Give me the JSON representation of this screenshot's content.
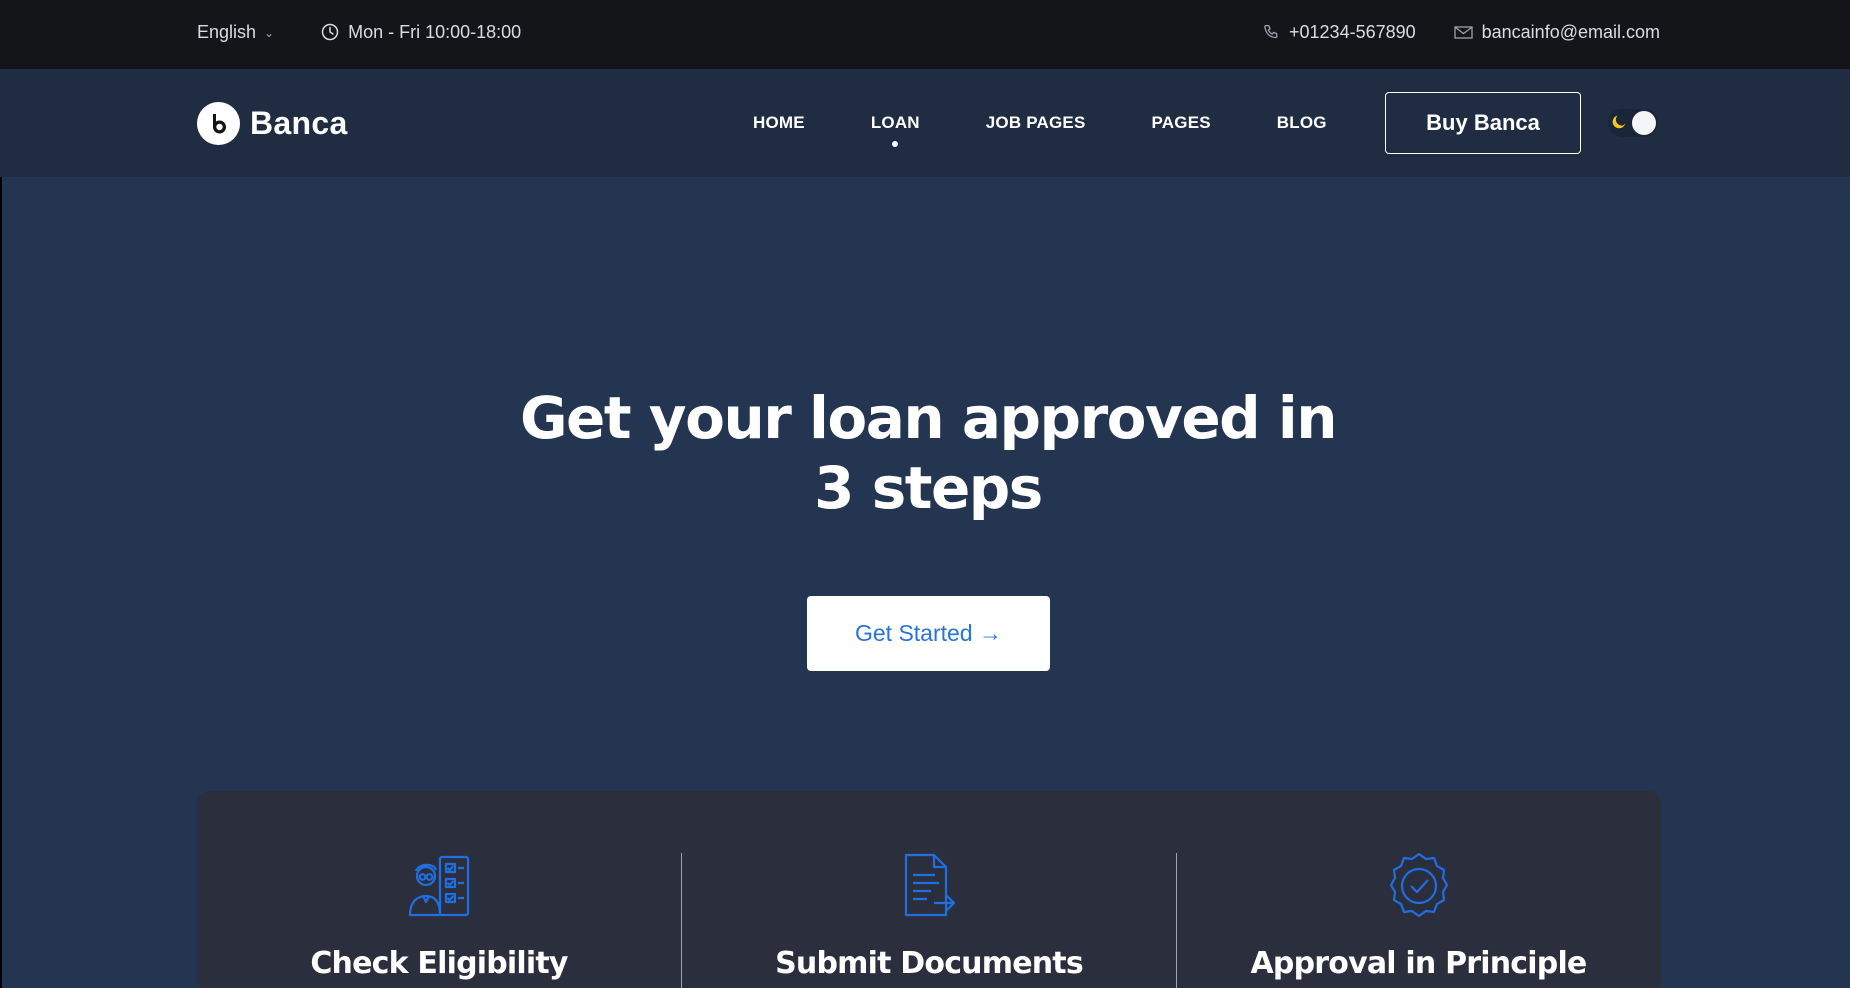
{
  "topbar": {
    "language": "English",
    "hours": "Mon - Fri 10:00-18:00",
    "phone": "+01234-567890",
    "email": "bancainfo@email.com"
  },
  "nav": {
    "logo_text": "Banca",
    "items": [
      {
        "label": "HOME",
        "active": false
      },
      {
        "label": "LOAN",
        "active": true
      },
      {
        "label": "JOB PAGES",
        "active": false
      },
      {
        "label": "PAGES",
        "active": false
      },
      {
        "label": "BLOG",
        "active": false
      }
    ],
    "buy_label": "Buy Banca"
  },
  "hero": {
    "title_line1": "Get your loan approved in",
    "title_line2": "3 steps",
    "cta_label": "Get Started →"
  },
  "steps": [
    {
      "label": "Check Eligibility",
      "icon": "checklist-person-icon"
    },
    {
      "label": "Submit Documents",
      "icon": "document-submit-icon"
    },
    {
      "label": "Approval in Principle",
      "icon": "verified-badge-icon"
    }
  ],
  "colors": {
    "topbar_bg": "#131519",
    "navbar_bg": "#1f2c42",
    "hero_bg": "#243551",
    "card_bg": "#2b2f3d",
    "accent_blue": "#2a73d9",
    "moon_yellow": "#f5c518"
  }
}
